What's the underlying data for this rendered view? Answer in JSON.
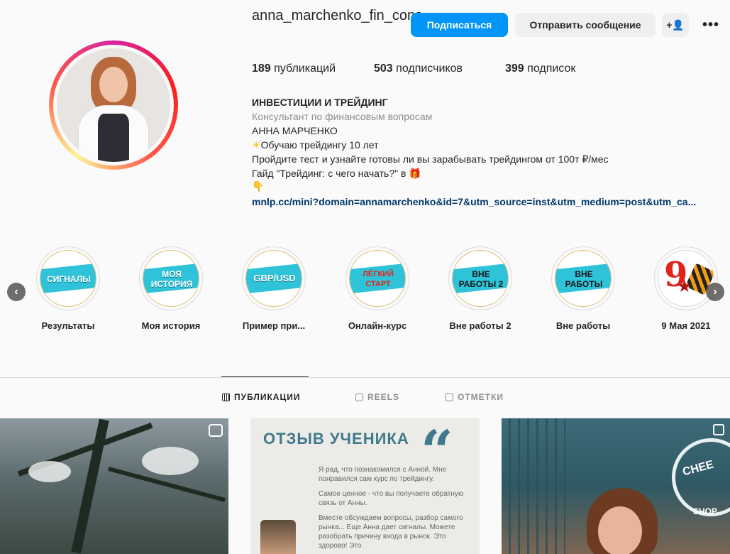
{
  "profile": {
    "username": "anna_marchenko_fin_cons",
    "follow_label": "Подписаться",
    "message_label": "Отправить сообщение",
    "add_label": "+👤",
    "more_label": "•••"
  },
  "stats": {
    "posts_count": "189",
    "posts_label": "публикаций",
    "followers_count": "503",
    "followers_label": "подписчиков",
    "following_count": "399",
    "following_label": "подписок"
  },
  "bio": {
    "title": "ИНВЕСТИЦИИ И ТРЕЙДИНГ",
    "category": "Консультант по финансовым вопросам",
    "name": "АННА МАРЧЕНКО",
    "line1_icon": "☀",
    "line1": "Обучаю трейдингу 10 лет",
    "line2": "Пройдите тест и узнайте готовы ли вы зарабывать трейдингом от 100т ₽/мес",
    "line3": "Гайд \"Трейдинг: с чего начать?\" в ",
    "line3_icon": "🎁",
    "line4_icon": "👇",
    "link": "mnlp.cc/mini?domain=annamarchenko&id=7&utm_source=inst&utm_medium=post&utm_ca..."
  },
  "highlights": [
    {
      "cover": "СИГНАЛЫ",
      "label": "Результаты"
    },
    {
      "cover": "МОЯ ИСТОРИЯ",
      "label": "Моя история"
    },
    {
      "cover": "GBP/USD",
      "label": "Пример при..."
    },
    {
      "cover": "ЛЁГКИЙ СТАРТ",
      "label": "Онлайн-курс"
    },
    {
      "cover": "ВНЕ РАБОТЫ 2",
      "label": "Вне работы 2"
    },
    {
      "cover": "ВНЕ РАБОТЫ",
      "label": "Вне работы"
    },
    {
      "cover": "9",
      "label": "9 Мая 2021"
    }
  ],
  "nav": {
    "prev": "‹",
    "next": "›"
  },
  "tabs": [
    {
      "label": "ПУБЛИКАЦИИ",
      "active": true
    },
    {
      "label": "REELS",
      "active": false
    },
    {
      "label": "ОТМЕТКИ",
      "active": false
    }
  ],
  "posts": {
    "review_title": "ОТЗЫВ УЧЕНИКА",
    "review_quote": "“",
    "review_p1": "Я рад, что познакомился с Анной. Мне понравился сам курс по трейдингу.",
    "review_p2": "Самое ценное - что вы получаете обратную связь от Анны.",
    "review_p3": "Вместе обсуждаем вопросы, разбор самого рынка... Еще Анна дает сигналы. Можете разобрать причину входа в рынок. Это здорово! Это",
    "cafe_sign": "CHEE",
    "cafe_shop": "SHOP"
  }
}
